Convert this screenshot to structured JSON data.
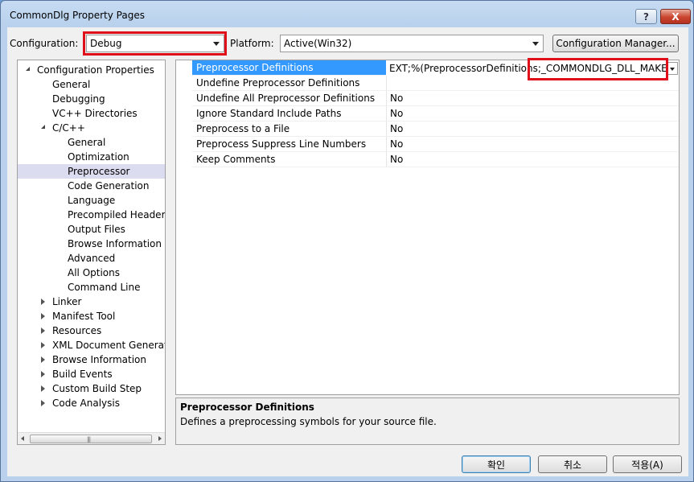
{
  "window": {
    "title": "CommonDlg Property Pages",
    "help_label": "?",
    "close_label": "X"
  },
  "config": {
    "label": "Configuration:",
    "value": "Debug",
    "platform_label": "Platform:",
    "platform_value": "Active(Win32)",
    "manager_label": "Configuration Manager..."
  },
  "tree": {
    "items": [
      {
        "label": "Configuration Properties",
        "level": 0,
        "expander": "open",
        "selected": false
      },
      {
        "label": "General",
        "level": 1,
        "expander": "none",
        "selected": false
      },
      {
        "label": "Debugging",
        "level": 1,
        "expander": "none",
        "selected": false
      },
      {
        "label": "VC++ Directories",
        "level": 1,
        "expander": "none",
        "selected": false
      },
      {
        "label": "C/C++",
        "level": 1,
        "expander": "open",
        "selected": false
      },
      {
        "label": "General",
        "level": 2,
        "expander": "none",
        "selected": false
      },
      {
        "label": "Optimization",
        "level": 2,
        "expander": "none",
        "selected": false
      },
      {
        "label": "Preprocessor",
        "level": 2,
        "expander": "none",
        "selected": true
      },
      {
        "label": "Code Generation",
        "level": 2,
        "expander": "none",
        "selected": false
      },
      {
        "label": "Language",
        "level": 2,
        "expander": "none",
        "selected": false
      },
      {
        "label": "Precompiled Headers",
        "level": 2,
        "expander": "none",
        "selected": false
      },
      {
        "label": "Output Files",
        "level": 2,
        "expander": "none",
        "selected": false
      },
      {
        "label": "Browse Information",
        "level": 2,
        "expander": "none",
        "selected": false
      },
      {
        "label": "Advanced",
        "level": 2,
        "expander": "none",
        "selected": false
      },
      {
        "label": "All Options",
        "level": 2,
        "expander": "none",
        "selected": false
      },
      {
        "label": "Command Line",
        "level": 2,
        "expander": "none",
        "selected": false
      },
      {
        "label": "Linker",
        "level": 1,
        "expander": "closed",
        "selected": false
      },
      {
        "label": "Manifest Tool",
        "level": 1,
        "expander": "closed",
        "selected": false
      },
      {
        "label": "Resources",
        "level": 1,
        "expander": "closed",
        "selected": false
      },
      {
        "label": "XML Document Generator",
        "level": 1,
        "expander": "closed",
        "selected": false
      },
      {
        "label": "Browse Information",
        "level": 1,
        "expander": "closed",
        "selected": false
      },
      {
        "label": "Build Events",
        "level": 1,
        "expander": "closed",
        "selected": false
      },
      {
        "label": "Custom Build Step",
        "level": 1,
        "expander": "closed",
        "selected": false
      },
      {
        "label": "Code Analysis",
        "level": 1,
        "expander": "closed",
        "selected": false
      }
    ],
    "scroll_grip": "|||"
  },
  "properties": {
    "rows": [
      {
        "name": "Preprocessor Definitions",
        "value": "",
        "selected": true
      },
      {
        "name": "Undefine Preprocessor Definitions",
        "value": "",
        "selected": false
      },
      {
        "name": "Undefine All Preprocessor Definitions",
        "value": "No",
        "selected": false
      },
      {
        "name": "Ignore Standard Include Paths",
        "value": "No",
        "selected": false
      },
      {
        "name": "Preprocess to a File",
        "value": "No",
        "selected": false
      },
      {
        "name": "Preprocess Suppress Line Numbers",
        "value": "No",
        "selected": false
      },
      {
        "name": "Keep Comments",
        "value": "No",
        "selected": false
      }
    ],
    "edit_value_prefix": "EXT;%(PreprocessorDefinitions",
    "edit_value_highlight": ";_COMMONDLG_DLL_MAKER"
  },
  "description": {
    "title": "Preprocessor Definitions",
    "text": "Defines a preprocessing symbols for your source file."
  },
  "buttons": {
    "ok": "확인",
    "cancel": "취소",
    "apply": "적용(A)"
  },
  "colors": {
    "highlight_red": "#e0101b",
    "selection_blue": "#3399ff"
  }
}
